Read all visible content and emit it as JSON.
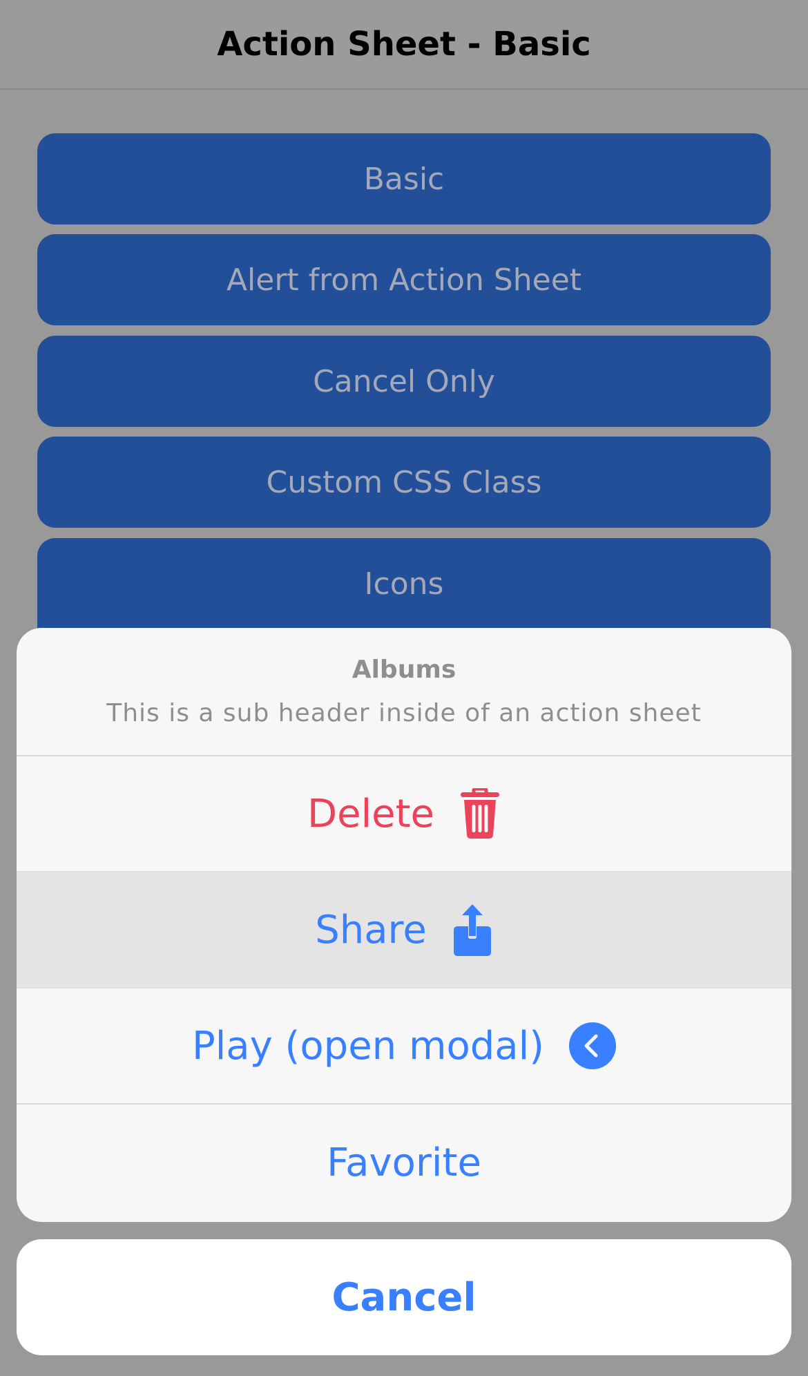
{
  "header": {
    "title": "Action Sheet - Basic"
  },
  "buttons": [
    {
      "label": "Basic"
    },
    {
      "label": "Alert from Action Sheet"
    },
    {
      "label": "Cancel Only"
    },
    {
      "label": "Custom CSS Class"
    },
    {
      "label": "Icons"
    }
  ],
  "sheet": {
    "title": "Albums",
    "subtitle": "This is a sub header inside of an action sheet",
    "items": [
      {
        "label": "Delete",
        "icon": "trash-icon",
        "role": "destructive"
      },
      {
        "label": "Share",
        "icon": "share-icon",
        "state": "pressed"
      },
      {
        "label": "Play (open modal)",
        "icon": "caret-back-circle-icon"
      },
      {
        "label": "Favorite"
      }
    ],
    "cancel_label": "Cancel"
  },
  "colors": {
    "backdrop": "#999999",
    "button_bg": "#224f97",
    "primary": "#3880ff",
    "danger": "#eb445a"
  }
}
